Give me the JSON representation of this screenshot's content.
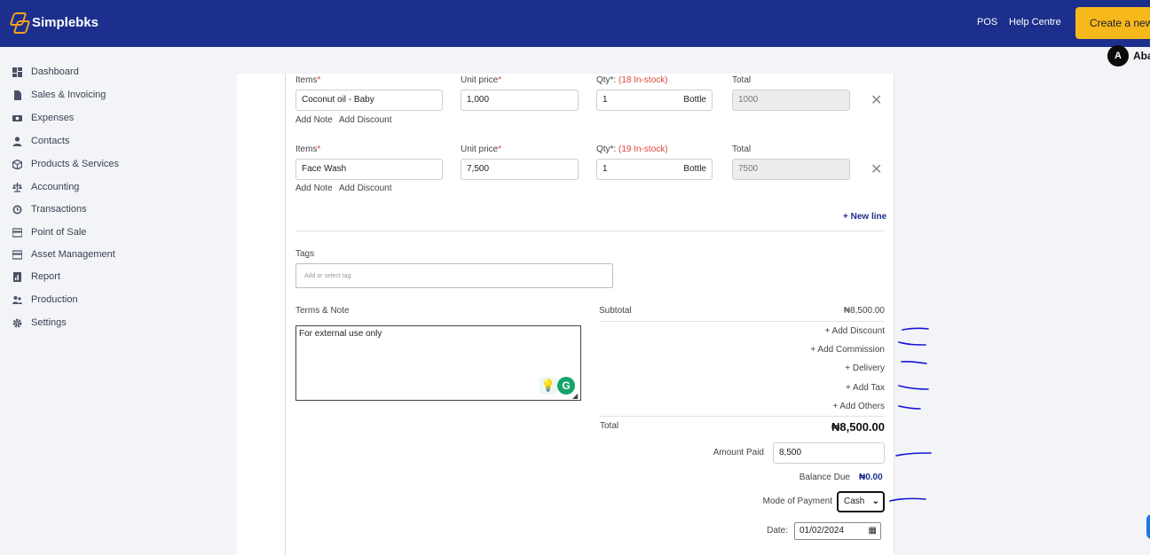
{
  "app": {
    "name": "Simplebks"
  },
  "topbar": {
    "pos_label": "POS",
    "help_label": "Help Centre",
    "create_label": "Create a new",
    "avatar_letter": "A",
    "user_name": "Aba"
  },
  "sidebar": {
    "items": [
      {
        "label": "Dashboard",
        "icon": "grid-icon"
      },
      {
        "label": "Sales & Invoicing",
        "icon": "document-icon"
      },
      {
        "label": "Expenses",
        "icon": "money-icon"
      },
      {
        "label": "Contacts",
        "icon": "user-icon"
      },
      {
        "label": "Products & Services",
        "icon": "box-icon"
      },
      {
        "label": "Accounting",
        "icon": "scale-icon"
      },
      {
        "label": "Transactions",
        "icon": "refresh-icon"
      },
      {
        "label": "Point of Sale",
        "icon": "card-icon"
      },
      {
        "label": "Asset Management",
        "icon": "card-icon"
      },
      {
        "label": "Report",
        "icon": "report-icon"
      },
      {
        "label": "Production",
        "icon": "people-icon"
      },
      {
        "label": "Settings",
        "icon": "gear-icon"
      }
    ]
  },
  "form": {
    "items_label": "Items",
    "unit_price_label": "Unit price",
    "qty_label": "Qty*: ",
    "total_label": "Total",
    "required_mark": "*",
    "add_note": "Add Note",
    "add_discount": "Add Discount",
    "lines": [
      {
        "item": "Coconut oil - Baby",
        "unit_price": "1,000",
        "qty": "1",
        "unit": "Bottle",
        "stock": "(18 In-stock)",
        "total": "1000"
      },
      {
        "item": "Face Wash",
        "unit_price": "7,500",
        "qty": "1",
        "unit": "Bottle",
        "stock": "(19 In-stock)",
        "total": "7500"
      }
    ],
    "new_line": "+ New line",
    "tags_label": "Tags",
    "tags_placeholder": "Add or select tag",
    "terms_label": "Terms & Note",
    "terms_value": "For external use only"
  },
  "summary": {
    "subtotal_label": "Subtotal",
    "subtotal_value": "₦8,500.00",
    "add_discount": "+ Add Discount",
    "add_commission": "+ Add Commission",
    "delivery": "+ Delivery",
    "add_tax": "+ Add Tax",
    "add_others": "+ Add Others",
    "total_label": "Total",
    "total_value": "₦8,500.00",
    "amount_paid_label": "Amount Paid",
    "amount_paid_value": "8,500",
    "balance_due_label": "Balance Due",
    "balance_due_value": "₦0.00",
    "mode_label": "Mode of Payment",
    "mode_value": "Cash",
    "date_label": "Date:",
    "date_value": "01/02/2024"
  },
  "colors": {
    "header": "#1c2f8c",
    "accent": "#f6b81b",
    "required": "#e0463b",
    "annotation": "#1414d8"
  }
}
